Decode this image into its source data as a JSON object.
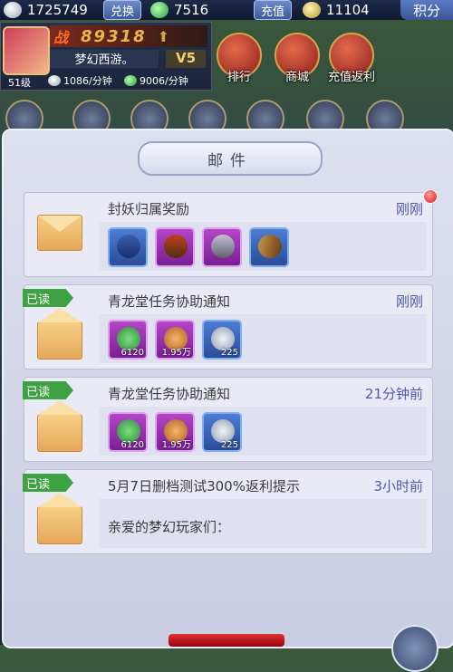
{
  "currency": {
    "silver": "1725749",
    "exchange_label": "兑换",
    "jade": "7516",
    "recharge_label": "充值",
    "gold": "11104",
    "points_label": "积分"
  },
  "player": {
    "zhan_label": "战",
    "power": "89318",
    "name": "梦幻西游。",
    "vip": "V5",
    "level": "51级",
    "silver_rate": "1086/分钟",
    "jade_rate": "9006/分钟"
  },
  "menu": {
    "rank": "排行",
    "shop": "商城",
    "recharge_rebate": "充值返利"
  },
  "mail_panel": {
    "title": "邮件",
    "read_label": "已读",
    "mails": [
      {
        "subject": "封妖归属奖励",
        "time": "刚刚",
        "items": []
      },
      {
        "subject": "青龙堂任务协助通知",
        "time": "刚刚",
        "items": [
          {
            "qty": "6120"
          },
          {
            "qty": "1.95万"
          },
          {
            "qty": "225"
          }
        ]
      },
      {
        "subject": "青龙堂任务协助通知",
        "time": "21分钟前",
        "items": [
          {
            "qty": "6120"
          },
          {
            "qty": "1.95万"
          },
          {
            "qty": "225"
          }
        ]
      },
      {
        "subject": "5月7日删档测试300%返利提示",
        "time": "3小时前",
        "greeting": "亲爱的梦幻玩家们："
      }
    ]
  }
}
